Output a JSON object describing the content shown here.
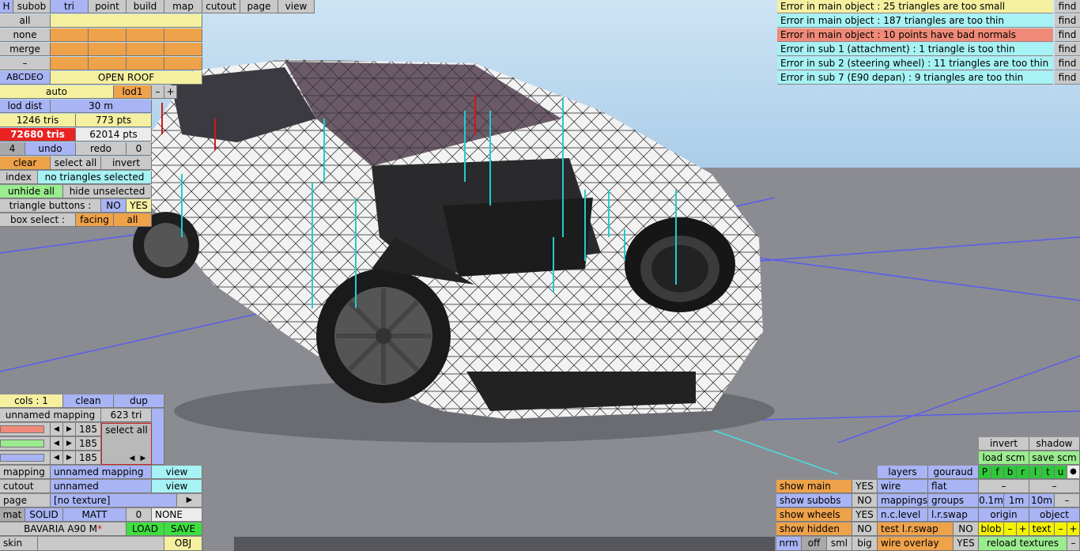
{
  "toolbar": {
    "h": "H",
    "tabs": [
      "subob",
      "tri",
      "point",
      "build",
      "map",
      "cutout",
      "page",
      "view"
    ]
  },
  "left_panel": {
    "sel_buttons": [
      "all",
      "none",
      "merge",
      "–"
    ],
    "lod_code": "ABCDEO",
    "lod_name": "OPEN ROOF",
    "auto": "auto",
    "lod1": "lod1",
    "minus": "–",
    "plus": "+",
    "lod_dist_label": "lod dist",
    "lod_dist": "30 m",
    "tris": "1246 tris",
    "pts": "773 pts",
    "total_tris": "72680 tris",
    "total_pts": "62014 pts",
    "undo_count": "4",
    "undo": "undo",
    "redo": "redo",
    "redo_count": "0",
    "clear": "clear",
    "select_all": "select all",
    "invert": "invert",
    "index": "index",
    "no_selection": "no triangles selected",
    "unhide_all": "unhide all",
    "hide_unselected": "hide unselected",
    "triangle_buttons": "triangle buttons :",
    "no": "NO",
    "yes": "YES",
    "box_select": "box select :",
    "facing": "facing",
    "all": "all"
  },
  "errors": [
    {
      "text": "Error in main object : 25 triangles are too small",
      "find": "find"
    },
    {
      "text": "Error in main object : 187 triangles are too thin",
      "find": "find"
    },
    {
      "text": "Error in main object : 10 points have bad normals",
      "find": "find"
    },
    {
      "text": "Error in sub 1 (attachment) : 1 triangle is too thin",
      "find": "find"
    },
    {
      "text": "Error in sub 2 (steering wheel) : 11 triangles are too thin",
      "find": "find"
    },
    {
      "text": "Error in sub 7 (E90 depan) : 9 triangles are too thin",
      "find": "find"
    }
  ],
  "mapping_panel": {
    "cols": "cols : 1",
    "clean": "clean",
    "dup": "dup",
    "mapping_name": "unnamed mapping",
    "mapping_tris": "623 tri",
    "rgb": [
      "185",
      "185",
      "185"
    ],
    "select_all": "select all",
    "mapping_label": "mapping",
    "mapping_value": "unnamed mapping",
    "view": "view",
    "cutout_label": "cutout",
    "cutout_value": "unnamed",
    "page_label": "page",
    "page_value": "[no texture]",
    "page_arrow": "▶",
    "mat": "mat",
    "solid": "SOLID",
    "matt": "MATT",
    "zero": "0",
    "none": "NONE",
    "car_name": "BAVARIA A90 M",
    "asterisk": "*",
    "load": "LOAD",
    "save": "SAVE",
    "skin": "skin",
    "obj": "OBJ"
  },
  "right_panel": {
    "invert": "invert",
    "shadow": "shadow",
    "load_scm": "load scm",
    "save_scm": "save scm",
    "flags": [
      "P",
      "f",
      "b",
      "r",
      "l",
      "t",
      "u",
      "●"
    ],
    "layers": "layers",
    "gouraud": "gouraud",
    "show_main": "show main",
    "wire": "wire",
    "flat": "flat",
    "show_subobs": "show subobs",
    "mappings": "mappings",
    "groups": "groups",
    "dist": [
      "0.1m",
      "1m",
      "10m",
      "–"
    ],
    "show_wheels": "show wheels",
    "nc_level": "n.c.level",
    "lr_swap": "l.r.swap",
    "origin": "origin",
    "object": "object",
    "show_hidden": "show hidden",
    "test_lr_swap": "test l.r.swap",
    "blob": "blob",
    "text": "text",
    "nrm": "nrm",
    "off": "off",
    "sml": "sml",
    "big": "big",
    "wire_overlay": "wire overlay",
    "reload_textures": "reload textures",
    "yes": "YES",
    "no": "NO",
    "dash": "–",
    "plus": "+"
  }
}
